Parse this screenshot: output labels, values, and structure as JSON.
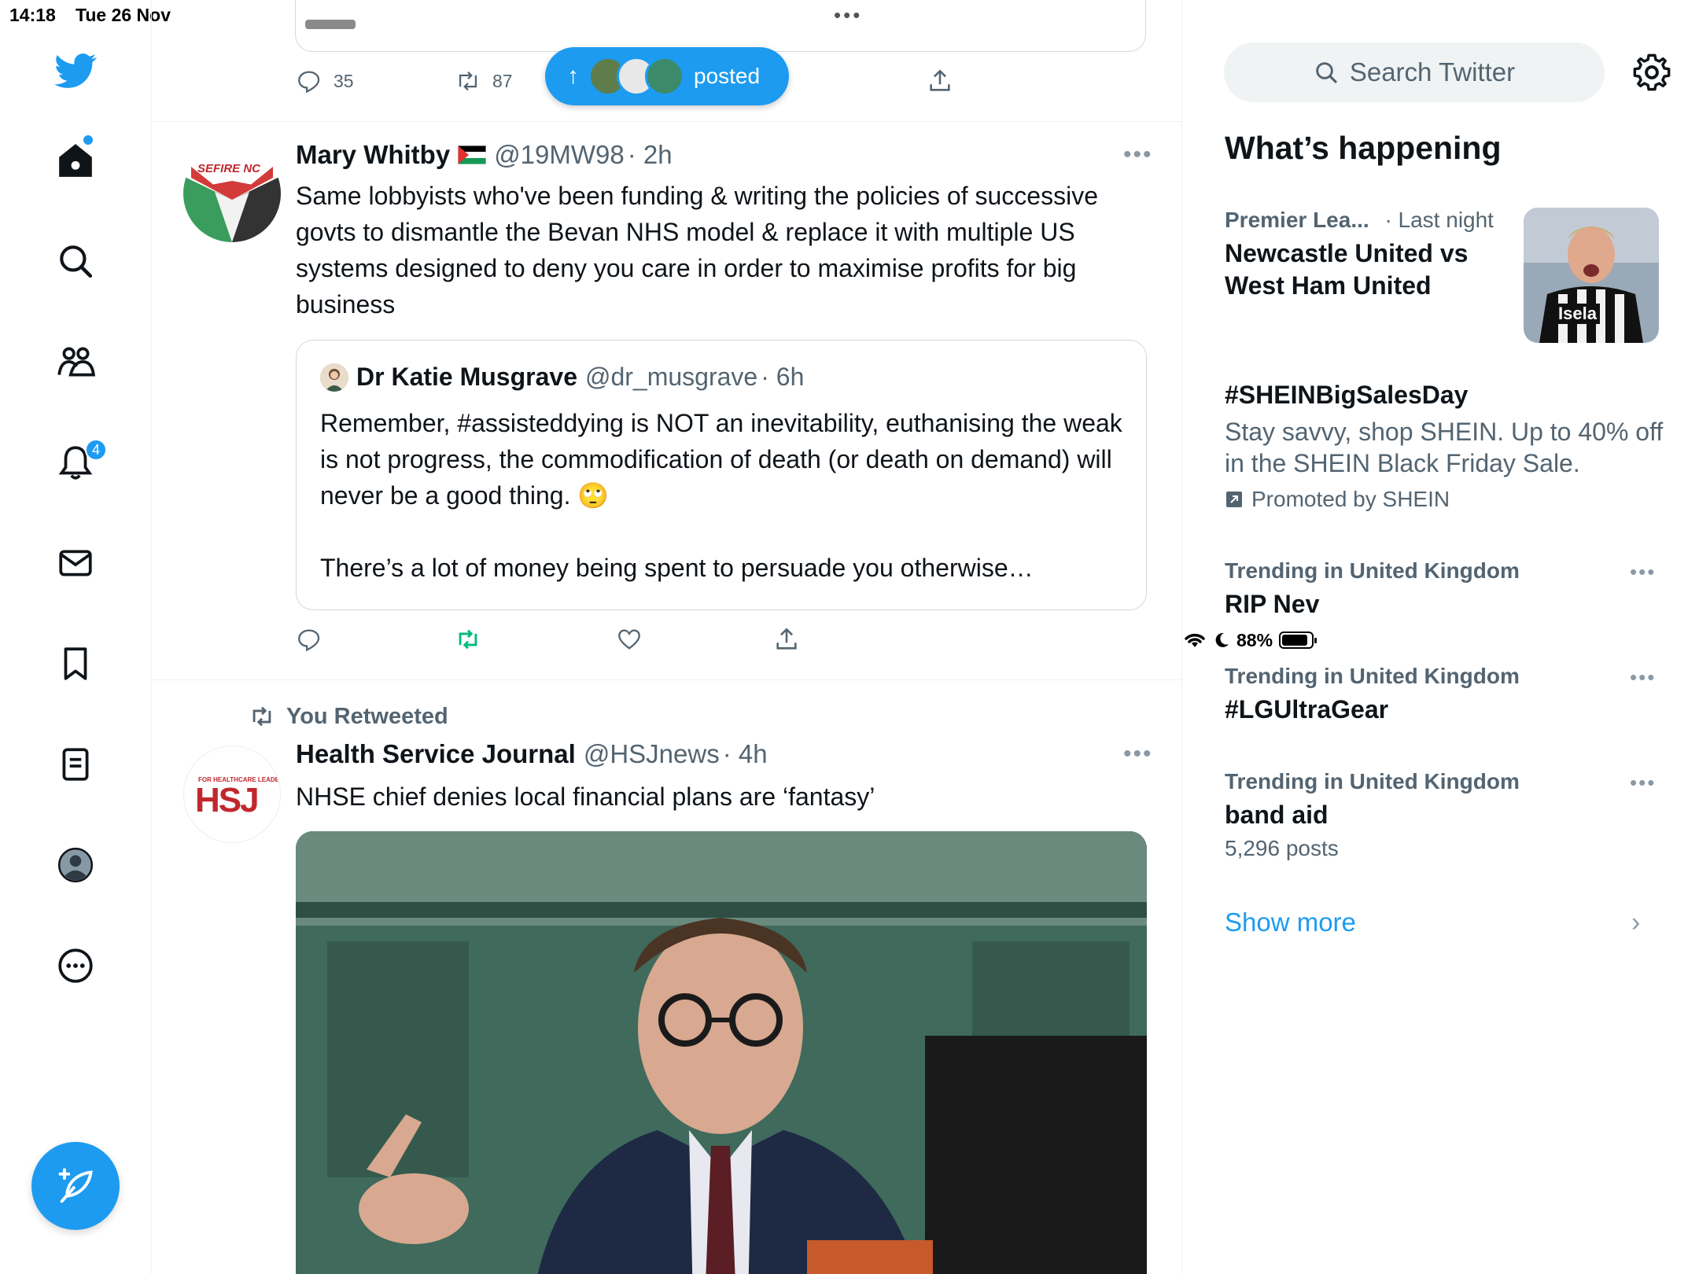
{
  "status_bar": {
    "time": "14:18",
    "date": "Tue 26 Nov",
    "battery": "88%",
    "battery_level": 0.88
  },
  "nav": {
    "notifications_badge": "4",
    "accent_color": "#1d9bf0"
  },
  "timeline": {
    "prev_tweet": {
      "reply_count": "35",
      "retweet_count": "87"
    },
    "posted_pill": {
      "label": "posted"
    },
    "tweet1": {
      "name": "Mary Whitby",
      "handle": "@19MW98",
      "time": "· 2h",
      "avatar_text": "SEFIRE NC",
      "text": "Same lobbyists who've been funding & writing the policies of successive govts to dismantle the Bevan NHS model & replace it with multiple US systems designed to deny you care in order to maximise profits for big business",
      "quote": {
        "name": "Dr Katie Musgrave",
        "handle": "@dr_musgrave",
        "time": "· 6h",
        "text1": "Remember, #assisteddying is NOT an inevitability, euthanising the weak is not progress, the commodification of death (or death on demand) will never be a good thing. 🙄",
        "text2": "There’s a lot of money being spent to persuade you otherwise…"
      }
    },
    "retweet_label": "You Retweeted",
    "tweet2": {
      "name": "Health Service Journal",
      "handle": "@HSJnews",
      "time": "· 4h",
      "avatar_top": "FOR HEALTHCARE LEADERS",
      "avatar_logo": "HSJ",
      "text": "NHSE chief denies local financial plans are ‘fantasy’"
    }
  },
  "sidebar": {
    "search_placeholder": "Search Twitter",
    "section_title": "What’s happening",
    "trends": [
      {
        "meta": "Premier Lea...",
        "meta_time": "· Last night",
        "title": "Newcastle United vs West Ham United",
        "thumb_text": "Isela"
      },
      {
        "title": "#SHEINBigSalesDay",
        "desc": "Stay savvy, shop SHEIN. Up to 40% off in the SHEIN Black Friday Sale.",
        "promoted": "Promoted by SHEIN"
      },
      {
        "meta": "Trending in United Kingdom",
        "title": "RIP Nev"
      },
      {
        "meta": "Trending in United Kingdom",
        "title": "#LGUltraGear"
      },
      {
        "meta": "Trending in United Kingdom",
        "title": "band aid",
        "posts": "5,296 posts"
      }
    ],
    "show_more": "Show more"
  }
}
